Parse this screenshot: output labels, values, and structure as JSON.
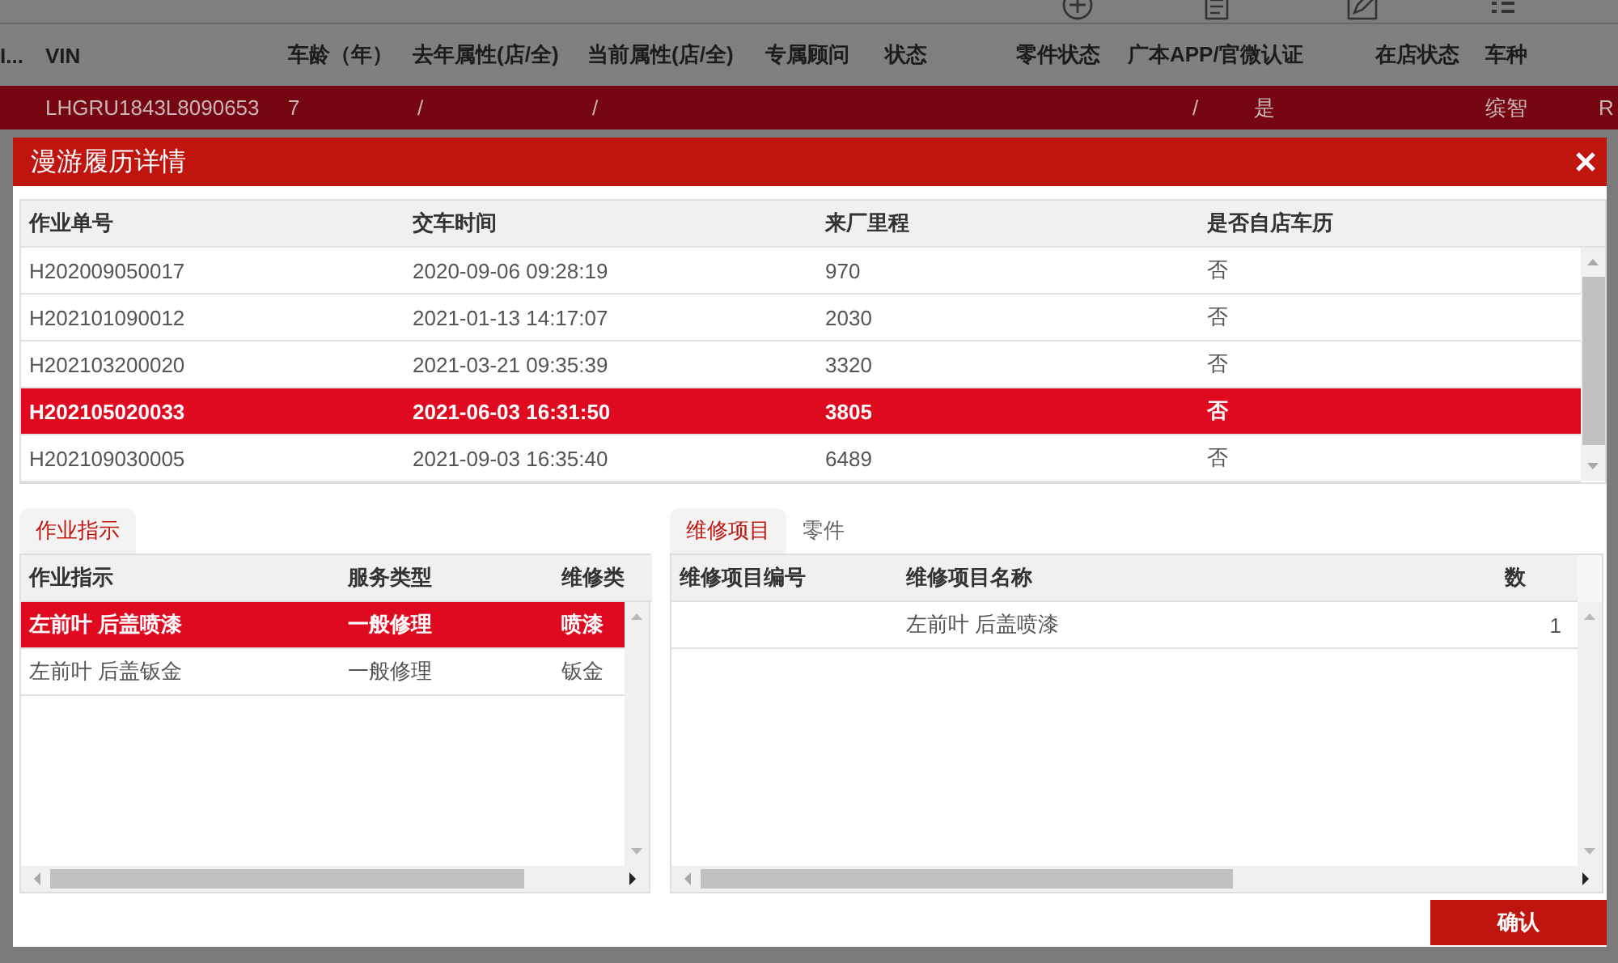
{
  "background": {
    "toolbar": [
      {
        "kind": "plus"
      },
      {
        "kind": "document"
      },
      {
        "kind": "pencil"
      },
      {
        "kind": "grid"
      }
    ],
    "table": {
      "columns": [
        "I...",
        "VIN",
        "车龄（年）",
        "去年属性(店/全)",
        "当前属性(店/全)",
        "专属顾问",
        "状态",
        "零件状态",
        "广本APP/官微认证",
        "在店状态",
        "车种"
      ],
      "rows": [
        {
          "selected": true,
          "vin": "LHGRU1843L8090653",
          "age": "7",
          "last_year": "/",
          "current": "/",
          "certification_mark": "/",
          "certification": "是",
          "model": "缤智",
          "column_12": "R"
        }
      ]
    }
  },
  "dialog": {
    "title": "漫游履历详情",
    "history": {
      "columns": [
        "作业单号",
        "交车时间",
        "来厂里程",
        "是否自店车历"
      ],
      "rows": [
        {
          "selected": false,
          "cells": [
            "H202009050017",
            "2020-09-06 09:28:19",
            "970",
            "否"
          ]
        },
        {
          "selected": false,
          "cells": [
            "H202101090012",
            "2021-01-13 14:17:07",
            "2030",
            "否"
          ]
        },
        {
          "selected": false,
          "cells": [
            "H202103200020",
            "2021-03-21 09:35:39",
            "3320",
            "否"
          ]
        },
        {
          "selected": true,
          "cells": [
            "H202105020033",
            "2021-06-03 16:31:50",
            "3805",
            "否"
          ]
        },
        {
          "selected": false,
          "cells": [
            "H202109030005",
            "2021-09-03 16:35:40",
            "6489",
            "否"
          ]
        }
      ]
    },
    "instructions": {
      "tabs": [
        {
          "label": "作业指示",
          "selected": true
        }
      ],
      "columns": [
        "作业指示",
        "服务类型",
        "维修类"
      ],
      "rows": [
        {
          "selected": true,
          "cells": [
            "左前叶 后盖喷漆",
            "一般修理",
            "喷漆"
          ]
        },
        {
          "selected": false,
          "cells": [
            "左前叶 后盖钣金",
            "一般修理",
            "钣金"
          ]
        }
      ]
    },
    "items": {
      "tabs": [
        {
          "label": "维修项目",
          "selected": true
        },
        {
          "label": "零件",
          "selected": false
        }
      ],
      "columns": [
        "维修项目编号",
        "维修项目名称",
        "数"
      ],
      "rows": [
        {
          "selected": false,
          "cells": [
            "",
            "左前叶 后盖喷漆",
            "1"
          ]
        }
      ]
    },
    "confirm": "确认"
  }
}
